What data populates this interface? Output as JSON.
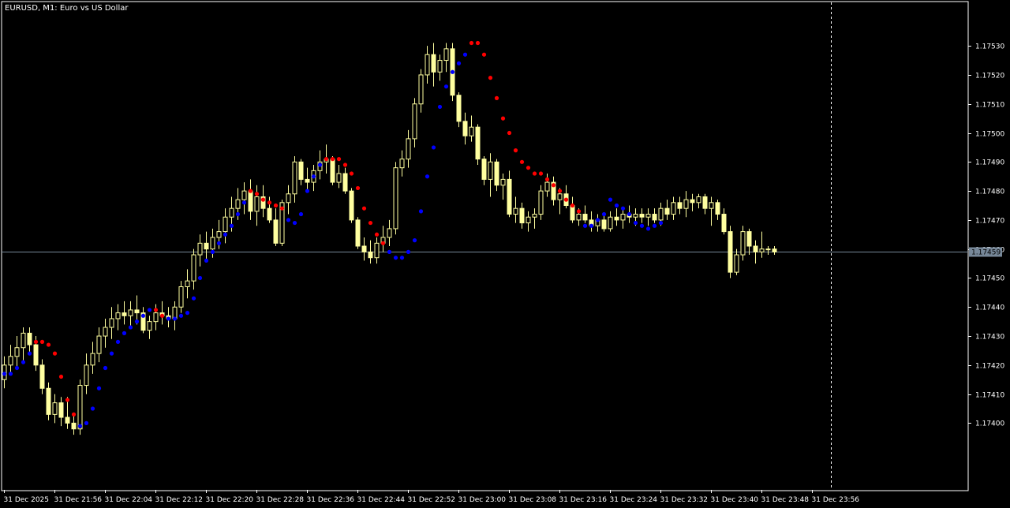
{
  "window": {
    "title": "EURUSD, M1:  Euro vs US Dollar"
  },
  "colors": {
    "background": "#000000",
    "frame": "#ffffff",
    "bull_candle_fill": "#000000",
    "bull_candle_stroke": "#ffffa0",
    "bear_candle_fill": "#ffffa0",
    "bear_candle_stroke": "#ffffa0",
    "sar_below": "#0000ff",
    "sar_above": "#ff0000",
    "bid_line": "#778899",
    "price_tag_bg": "#778899",
    "cursor_line": "#ffffff"
  },
  "current_price": {
    "value": 1.17459,
    "label": "1.17459"
  },
  "chart_data": {
    "type": "candlestick",
    "symbol": "EURUSD",
    "timeframe": "M1",
    "ylim": [
      1.17377,
      1.17545
    ],
    "y_ticks": [
      {
        "value": 1.1753,
        "label": "1.17530"
      },
      {
        "value": 1.1752,
        "label": "1.17520"
      },
      {
        "value": 1.1751,
        "label": "1.17510"
      },
      {
        "value": 1.175,
        "label": "1.17500"
      },
      {
        "value": 1.1749,
        "label": "1.17490"
      },
      {
        "value": 1.1748,
        "label": "1.17480"
      },
      {
        "value": 1.1747,
        "label": "1.17470"
      },
      {
        "value": 1.1746,
        "label": "1.17460"
      },
      {
        "value": 1.1745,
        "label": "1.17450"
      },
      {
        "value": 1.1744,
        "label": "1.17440"
      },
      {
        "value": 1.1743,
        "label": "1.17430"
      },
      {
        "value": 1.1742,
        "label": "1.17420"
      },
      {
        "value": 1.1741,
        "label": "1.17410"
      },
      {
        "value": 1.174,
        "label": "1.17400"
      }
    ],
    "x_ticks": [
      {
        "index": 0,
        "label": "31 Dec 2025"
      },
      {
        "index": 8,
        "label": "31 Dec 21:56"
      },
      {
        "index": 16,
        "label": "31 Dec 22:04"
      },
      {
        "index": 24,
        "label": "31 Dec 22:12"
      },
      {
        "index": 32,
        "label": "31 Dec 22:20"
      },
      {
        "index": 40,
        "label": "31 Dec 22:28"
      },
      {
        "index": 48,
        "label": "31 Dec 22:36"
      },
      {
        "index": 56,
        "label": "31 Dec 22:44"
      },
      {
        "index": 64,
        "label": "31 Dec 22:52"
      },
      {
        "index": 72,
        "label": "31 Dec 23:00"
      },
      {
        "index": 80,
        "label": "31 Dec 23:08"
      },
      {
        "index": 88,
        "label": "31 Dec 23:16"
      },
      {
        "index": 96,
        "label": "31 Dec 23:24"
      },
      {
        "index": 104,
        "label": "31 Dec 23:32"
      },
      {
        "index": 112,
        "label": "31 Dec 23:40"
      },
      {
        "index": 120,
        "label": "31 Dec 23:48"
      },
      {
        "index": 128,
        "label": "31 Dec 23:56"
      }
    ],
    "cursor_index": 131,
    "candles": [
      [
        1.17415,
        1.17423,
        1.17412,
        1.1742
      ],
      [
        1.1742,
        1.17427,
        1.17417,
        1.17423
      ],
      [
        1.17423,
        1.1743,
        1.17419,
        1.17426
      ],
      [
        1.17426,
        1.17433,
        1.17421,
        1.17431
      ],
      [
        1.17431,
        1.17433,
        1.17424,
        1.17427
      ],
      [
        1.17427,
        1.1743,
        1.17418,
        1.1742
      ],
      [
        1.1742,
        1.17422,
        1.1741,
        1.17412
      ],
      [
        1.17412,
        1.17414,
        1.17401,
        1.17403
      ],
      [
        1.17403,
        1.1741,
        1.174,
        1.17407
      ],
      [
        1.17407,
        1.17409,
        1.17399,
        1.17402
      ],
      [
        1.17402,
        1.17409,
        1.17398,
        1.174
      ],
      [
        1.174,
        1.17403,
        1.17396,
        1.17398
      ],
      [
        1.17398,
        1.17415,
        1.17396,
        1.17413
      ],
      [
        1.17413,
        1.17424,
        1.1741,
        1.1742
      ],
      [
        1.1742,
        1.17428,
        1.17417,
        1.17424
      ],
      [
        1.17424,
        1.17433,
        1.17421,
        1.1743
      ],
      [
        1.1743,
        1.17436,
        1.17426,
        1.17433
      ],
      [
        1.17433,
        1.1744,
        1.17429,
        1.17436
      ],
      [
        1.17436,
        1.17441,
        1.17432,
        1.17438
      ],
      [
        1.17438,
        1.17442,
        1.17434,
        1.17437
      ],
      [
        1.17437,
        1.17442,
        1.17433,
        1.17439
      ],
      [
        1.17439,
        1.17444,
        1.17434,
        1.17438
      ],
      [
        1.17438,
        1.1744,
        1.17431,
        1.17432
      ],
      [
        1.17432,
        1.17437,
        1.17429,
        1.17435
      ],
      [
        1.17435,
        1.17441,
        1.17432,
        1.17438
      ],
      [
        1.17438,
        1.17442,
        1.17434,
        1.17437
      ],
      [
        1.17437,
        1.1744,
        1.17433,
        1.17436
      ],
      [
        1.17436,
        1.17442,
        1.17432,
        1.1744
      ],
      [
        1.1744,
        1.17449,
        1.17438,
        1.17447
      ],
      [
        1.17447,
        1.17453,
        1.17443,
        1.17449
      ],
      [
        1.17449,
        1.1746,
        1.17446,
        1.17458
      ],
      [
        1.17458,
        1.17465,
        1.17454,
        1.17462
      ],
      [
        1.17462,
        1.17466,
        1.17456,
        1.1746
      ],
      [
        1.1746,
        1.17467,
        1.17457,
        1.17464
      ],
      [
        1.17464,
        1.1747,
        1.1746,
        1.17466
      ],
      [
        1.17466,
        1.17474,
        1.17462,
        1.17471
      ],
      [
        1.17471,
        1.17478,
        1.17466,
        1.17474
      ],
      [
        1.17474,
        1.17481,
        1.1747,
        1.17477
      ],
      [
        1.17477,
        1.17483,
        1.17472,
        1.1748
      ],
      [
        1.1748,
        1.17484,
        1.1747,
        1.17473
      ],
      [
        1.17473,
        1.17482,
        1.17468,
        1.17478
      ],
      [
        1.17478,
        1.17482,
        1.17471,
        1.17474
      ],
      [
        1.17474,
        1.17478,
        1.17469,
        1.1747
      ],
      [
        1.1747,
        1.17474,
        1.17461,
        1.17462
      ],
      [
        1.17462,
        1.17477,
        1.17461,
        1.17476
      ],
      [
        1.17476,
        1.17482,
        1.17472,
        1.17479
      ],
      [
        1.17479,
        1.17492,
        1.17476,
        1.1749
      ],
      [
        1.1749,
        1.17491,
        1.17482,
        1.17484
      ],
      [
        1.17484,
        1.17488,
        1.1748,
        1.17483
      ],
      [
        1.17483,
        1.17489,
        1.1748,
        1.17487
      ],
      [
        1.17487,
        1.17494,
        1.17484,
        1.1749
      ],
      [
        1.1749,
        1.17496,
        1.17486,
        1.17491
      ],
      [
        1.17491,
        1.17492,
        1.17482,
        1.17483
      ],
      [
        1.17483,
        1.17489,
        1.17481,
        1.17486
      ],
      [
        1.17486,
        1.17488,
        1.17479,
        1.1748
      ],
      [
        1.1748,
        1.17481,
        1.17469,
        1.1747
      ],
      [
        1.1747,
        1.17471,
        1.1746,
        1.17461
      ],
      [
        1.17461,
        1.17464,
        1.17456,
        1.17459
      ],
      [
        1.17459,
        1.17463,
        1.17455,
        1.17457
      ],
      [
        1.17457,
        1.17464,
        1.17455,
        1.17462
      ],
      [
        1.17462,
        1.17468,
        1.17459,
        1.17464
      ],
      [
        1.17464,
        1.1747,
        1.17461,
        1.17467
      ],
      [
        1.17467,
        1.1749,
        1.17465,
        1.17488
      ],
      [
        1.17488,
        1.17494,
        1.17485,
        1.17491
      ],
      [
        1.17491,
        1.17501,
        1.17488,
        1.17498
      ],
      [
        1.17498,
        1.17512,
        1.17495,
        1.1751
      ],
      [
        1.1751,
        1.17522,
        1.17507,
        1.1752
      ],
      [
        1.1752,
        1.1753,
        1.17517,
        1.17527
      ],
      [
        1.17527,
        1.17531,
        1.17516,
        1.17521
      ],
      [
        1.17521,
        1.17527,
        1.17518,
        1.17525
      ],
      [
        1.17525,
        1.17531,
        1.17521,
        1.17529
      ],
      [
        1.17529,
        1.17531,
        1.17511,
        1.17513
      ],
      [
        1.17513,
        1.17514,
        1.17502,
        1.17504
      ],
      [
        1.17504,
        1.17507,
        1.17496,
        1.17499
      ],
      [
        1.17499,
        1.17506,
        1.17497,
        1.17502
      ],
      [
        1.17502,
        1.17503,
        1.17489,
        1.17491
      ],
      [
        1.17491,
        1.17492,
        1.17482,
        1.17484
      ],
      [
        1.17484,
        1.17493,
        1.17478,
        1.1749
      ],
      [
        1.1749,
        1.17491,
        1.1748,
        1.17482
      ],
      [
        1.17482,
        1.17486,
        1.17477,
        1.17484
      ],
      [
        1.17484,
        1.17487,
        1.17471,
        1.17472
      ],
      [
        1.17472,
        1.17478,
        1.17469,
        1.17474
      ],
      [
        1.17474,
        1.17476,
        1.17467,
        1.17469
      ],
      [
        1.17469,
        1.17473,
        1.17466,
        1.17471
      ],
      [
        1.17471,
        1.17474,
        1.17467,
        1.17472
      ],
      [
        1.17472,
        1.17482,
        1.1747,
        1.1748
      ],
      [
        1.1748,
        1.17486,
        1.17478,
        1.17483
      ],
      [
        1.17483,
        1.17485,
        1.17475,
        1.17477
      ],
      [
        1.17477,
        1.17481,
        1.17472,
        1.17479
      ],
      [
        1.17479,
        1.17482,
        1.17474,
        1.17475
      ],
      [
        1.17475,
        1.17478,
        1.17469,
        1.1747
      ],
      [
        1.1747,
        1.17474,
        1.17468,
        1.17472
      ],
      [
        1.17472,
        1.17475,
        1.17469,
        1.1747
      ],
      [
        1.1747,
        1.17473,
        1.17466,
        1.17468
      ],
      [
        1.17468,
        1.17472,
        1.17466,
        1.1747
      ],
      [
        1.1747,
        1.17472,
        1.17466,
        1.17467
      ],
      [
        1.17467,
        1.17473,
        1.17466,
        1.17471
      ],
      [
        1.17471,
        1.17474,
        1.17468,
        1.1747
      ],
      [
        1.1747,
        1.17474,
        1.17467,
        1.17472
      ],
      [
        1.17472,
        1.17475,
        1.17469,
        1.17471
      ],
      [
        1.17471,
        1.17474,
        1.17468,
        1.17472
      ],
      [
        1.17472,
        1.17474,
        1.17469,
        1.17471
      ],
      [
        1.17471,
        1.17474,
        1.17468,
        1.17472
      ],
      [
        1.17472,
        1.17474,
        1.17469,
        1.1747
      ],
      [
        1.1747,
        1.17476,
        1.17468,
        1.17474
      ],
      [
        1.17474,
        1.17477,
        1.1747,
        1.17472
      ],
      [
        1.17472,
        1.17478,
        1.1747,
        1.17476
      ],
      [
        1.17476,
        1.17478,
        1.17472,
        1.17474
      ],
      [
        1.17474,
        1.1748,
        1.17471,
        1.17477
      ],
      [
        1.17477,
        1.17479,
        1.17473,
        1.17476
      ],
      [
        1.17476,
        1.17479,
        1.17474,
        1.17478
      ],
      [
        1.17478,
        1.17479,
        1.17472,
        1.17474
      ],
      [
        1.17474,
        1.17478,
        1.17468,
        1.17476
      ],
      [
        1.17476,
        1.17477,
        1.1747,
        1.17472
      ],
      [
        1.17472,
        1.17474,
        1.17465,
        1.17466
      ],
      [
        1.17466,
        1.17468,
        1.1745,
        1.17452
      ],
      [
        1.17452,
        1.1746,
        1.17451,
        1.17458
      ],
      [
        1.17458,
        1.17468,
        1.17456,
        1.17466
      ],
      [
        1.17466,
        1.17467,
        1.17458,
        1.17461
      ],
      [
        1.17461,
        1.17463,
        1.17455,
        1.17459
      ],
      [
        1.17459,
        1.17466,
        1.17457,
        1.1746
      ],
      [
        1.1746,
        1.17461,
        1.17458,
        1.1746
      ],
      [
        1.1746,
        1.17461,
        1.17458,
        1.17459
      ]
    ],
    "sar": [
      [
        0,
        1.17417,
        "below"
      ],
      [
        1,
        1.17417,
        "below"
      ],
      [
        2,
        1.17419,
        "below"
      ],
      [
        3,
        1.17421,
        "below"
      ],
      [
        4,
        1.17424,
        "below"
      ],
      [
        5,
        1.17428,
        "above"
      ],
      [
        6,
        1.17428,
        "above"
      ],
      [
        7,
        1.17427,
        "above"
      ],
      [
        8,
        1.17424,
        "above"
      ],
      [
        9,
        1.17416,
        "above"
      ],
      [
        10,
        1.17408,
        "above"
      ],
      [
        11,
        1.17403,
        "above"
      ],
      [
        12,
        1.17399,
        "below"
      ],
      [
        13,
        1.174,
        "below"
      ],
      [
        14,
        1.17405,
        "below"
      ],
      [
        15,
        1.17412,
        "below"
      ],
      [
        16,
        1.17419,
        "below"
      ],
      [
        17,
        1.17424,
        "below"
      ],
      [
        18,
        1.17428,
        "below"
      ],
      [
        19,
        1.17431,
        "below"
      ],
      [
        20,
        1.17433,
        "below"
      ],
      [
        21,
        1.17435,
        "below"
      ],
      [
        22,
        1.17437,
        "below"
      ],
      [
        23,
        1.17439,
        "below"
      ],
      [
        24,
        1.17439,
        "above"
      ],
      [
        25,
        1.17437,
        "above"
      ],
      [
        26,
        1.17436,
        "below"
      ],
      [
        27,
        1.17436,
        "below"
      ],
      [
        28,
        1.17437,
        "below"
      ],
      [
        29,
        1.17438,
        "below"
      ],
      [
        30,
        1.17443,
        "below"
      ],
      [
        31,
        1.1745,
        "below"
      ],
      [
        32,
        1.17456,
        "below"
      ],
      [
        33,
        1.17459,
        "below"
      ],
      [
        34,
        1.17462,
        "below"
      ],
      [
        35,
        1.17465,
        "below"
      ],
      [
        36,
        1.17468,
        "below"
      ],
      [
        37,
        1.17472,
        "below"
      ],
      [
        38,
        1.17476,
        "below"
      ],
      [
        39,
        1.1748,
        "above"
      ],
      [
        40,
        1.17479,
        "above"
      ],
      [
        41,
        1.17477,
        "above"
      ],
      [
        42,
        1.17476,
        "above"
      ],
      [
        43,
        1.17475,
        "above"
      ],
      [
        44,
        1.17474,
        "above"
      ],
      [
        45,
        1.1747,
        "below"
      ],
      [
        46,
        1.17469,
        "below"
      ],
      [
        47,
        1.17472,
        "below"
      ],
      [
        48,
        1.1748,
        "below"
      ],
      [
        49,
        1.17485,
        "below"
      ],
      [
        50,
        1.17489,
        "below"
      ],
      [
        51,
        1.17491,
        "above"
      ],
      [
        52,
        1.17491,
        "above"
      ],
      [
        53,
        1.17491,
        "above"
      ],
      [
        54,
        1.17489,
        "above"
      ],
      [
        55,
        1.17486,
        "above"
      ],
      [
        56,
        1.17481,
        "above"
      ],
      [
        57,
        1.17474,
        "above"
      ],
      [
        58,
        1.17469,
        "above"
      ],
      [
        59,
        1.17465,
        "above"
      ],
      [
        60,
        1.17462,
        "above"
      ],
      [
        61,
        1.17459,
        "below"
      ],
      [
        62,
        1.17457,
        "below"
      ],
      [
        63,
        1.17457,
        "below"
      ],
      [
        64,
        1.17459,
        "below"
      ],
      [
        65,
        1.17463,
        "below"
      ],
      [
        66,
        1.17473,
        "below"
      ],
      [
        67,
        1.17485,
        "below"
      ],
      [
        68,
        1.17495,
        "below"
      ],
      [
        69,
        1.17509,
        "below"
      ],
      [
        70,
        1.17516,
        "below"
      ],
      [
        71,
        1.17521,
        "below"
      ],
      [
        72,
        1.17524,
        "below"
      ],
      [
        73,
        1.17527,
        "below"
      ],
      [
        74,
        1.17531,
        "above"
      ],
      [
        75,
        1.17531,
        "above"
      ],
      [
        76,
        1.17527,
        "above"
      ],
      [
        77,
        1.17519,
        "above"
      ],
      [
        78,
        1.17512,
        "above"
      ],
      [
        79,
        1.17505,
        "above"
      ],
      [
        80,
        1.175,
        "above"
      ],
      [
        81,
        1.17494,
        "above"
      ],
      [
        82,
        1.1749,
        "above"
      ],
      [
        83,
        1.17488,
        "above"
      ],
      [
        84,
        1.17486,
        "above"
      ],
      [
        85,
        1.17486,
        "above"
      ],
      [
        86,
        1.17484,
        "above"
      ],
      [
        87,
        1.17482,
        "above"
      ],
      [
        88,
        1.1748,
        "above"
      ],
      [
        89,
        1.17477,
        "above"
      ],
      [
        90,
        1.17475,
        "above"
      ],
      [
        91,
        1.17473,
        "above"
      ],
      [
        92,
        1.17468,
        "below"
      ],
      [
        93,
        1.17468,
        "below"
      ],
      [
        94,
        1.1747,
        "below"
      ],
      [
        95,
        1.17472,
        "below"
      ],
      [
        96,
        1.17477,
        "below"
      ],
      [
        97,
        1.17475,
        "below"
      ],
      [
        98,
        1.17474,
        "below"
      ],
      [
        99,
        1.17472,
        "below"
      ],
      [
        100,
        1.17469,
        "below"
      ],
      [
        101,
        1.17468,
        "below"
      ],
      [
        102,
        1.17467,
        "below"
      ],
      [
        103,
        1.17468,
        "below"
      ],
      [
        104,
        1.17469,
        "below"
      ]
    ]
  }
}
